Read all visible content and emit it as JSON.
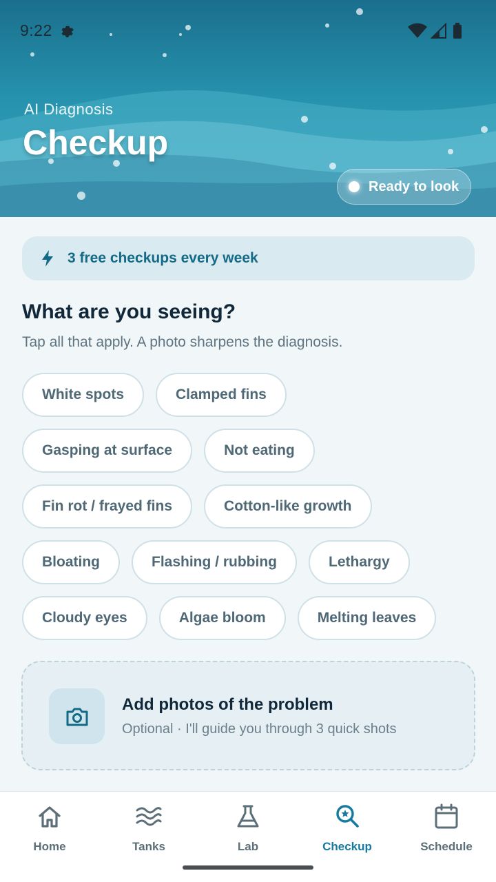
{
  "status_bar": {
    "time": "9:22"
  },
  "header": {
    "eyebrow": "AI Diagnosis",
    "title": "Checkup",
    "status_pill": "Ready to look"
  },
  "banner": {
    "text": "3 free checkups every week"
  },
  "section": {
    "title": "What are you seeing?",
    "subtitle": "Tap all that apply. A photo sharpens the diagnosis."
  },
  "symptoms": [
    [
      "White spots",
      "Clamped fins"
    ],
    [
      "Gasping at surface",
      "Not eating"
    ],
    [
      "Fin rot / frayed fins",
      "Cotton-like growth"
    ],
    [
      "Bloating",
      "Flashing / rubbing",
      "Lethargy"
    ],
    [
      "Cloudy eyes",
      "Algae bloom",
      "Melting leaves"
    ]
  ],
  "photo_card": {
    "title": "Add photos of the problem",
    "subtitle": "Optional · I'll guide you through 3 quick shots"
  },
  "nav": [
    {
      "label": "Home",
      "icon": "home-icon",
      "active": false
    },
    {
      "label": "Tanks",
      "icon": "waves-icon",
      "active": false
    },
    {
      "label": "Lab",
      "icon": "flask-icon",
      "active": false
    },
    {
      "label": "Checkup",
      "icon": "search-icon",
      "active": true
    },
    {
      "label": "Schedule",
      "icon": "calendar-icon",
      "active": false
    }
  ],
  "colors": {
    "accent": "#1579a0",
    "header_top": "#1a6f8d",
    "header_bottom": "#3aa3bb",
    "chip_text": "#4f6876",
    "banner_bg": "#d9eaf0"
  }
}
